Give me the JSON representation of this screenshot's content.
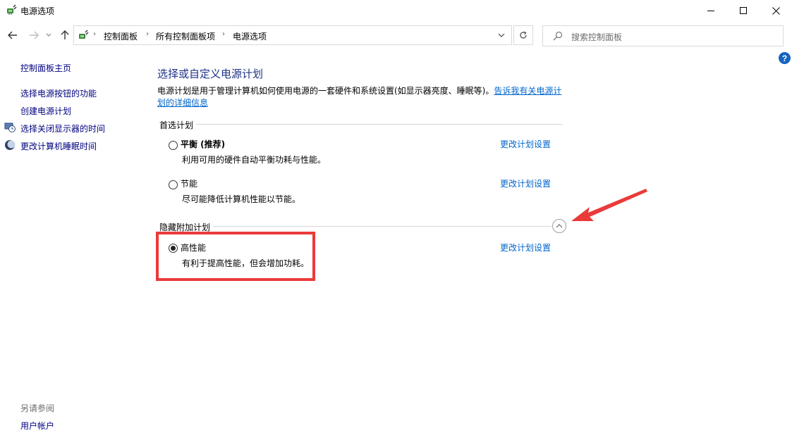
{
  "window": {
    "title": "电源选项",
    "minimize_icon": "minimize-icon",
    "maximize_icon": "maximize-icon",
    "close_icon": "close-icon"
  },
  "navbar": {
    "back_icon": "arrow-left-icon",
    "forward_icon": "arrow-right-icon",
    "recent_icon": "chevron-down-icon",
    "up_icon": "arrow-up-icon",
    "breadcrumbs": [
      "控制面板",
      "所有控制面板项",
      "电源选项"
    ],
    "refresh_icon": "refresh-icon",
    "search_placeholder": "搜索控制面板"
  },
  "help": {
    "label": "?"
  },
  "sidebar": {
    "home": "控制面板主页",
    "items": [
      {
        "label": "选择电源按钮的功能"
      },
      {
        "label": "创建电源计划"
      },
      {
        "label": "选择关闭显示器的时间",
        "icon": "display-clock-icon"
      },
      {
        "label": "更改计算机睡眠时间",
        "icon": "moon-icon"
      }
    ],
    "see_also_title": "另请参阅",
    "see_also_items": [
      "用户帐户"
    ]
  },
  "main": {
    "title": "选择或自定义电源计划",
    "description": "电源计划是用于管理计算机如何使用电源的一套硬件和系统设置(如显示器亮度、睡眠等)。",
    "description_link": "告诉我有关电源计划的详细信息",
    "preferred_group": "首选计划",
    "hidden_group": "隐藏附加计划",
    "change_settings_label": "更改计划设置",
    "plans": [
      {
        "name": "平衡 (推荐)",
        "description": "利用可用的硬件自动平衡功耗与性能。",
        "selected": false
      },
      {
        "name": "节能",
        "description": "尽可能降低计算机性能以节能。",
        "selected": false
      },
      {
        "name": "高性能",
        "description": "有利于提高性能，但会增加功耗。",
        "selected": true
      }
    ]
  },
  "annotations": {
    "highlight_color": "#ea3a3a",
    "arrow_color": "#ea3a3a"
  }
}
